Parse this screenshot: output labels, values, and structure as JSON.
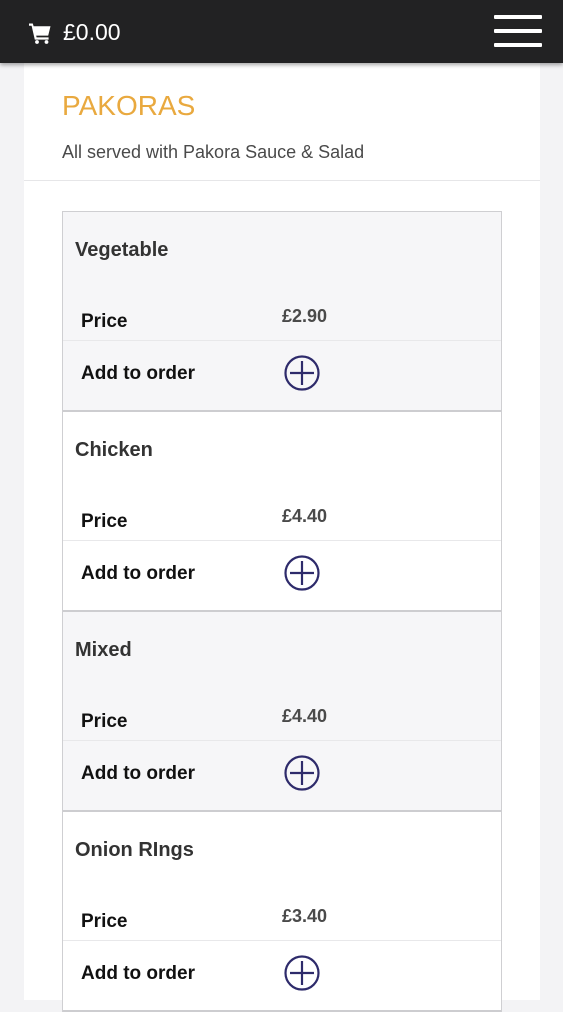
{
  "header": {
    "cart_icon": "shopping-cart-icon",
    "cart_total": "£0.00",
    "menu_icon": "hamburger-menu-icon"
  },
  "section": {
    "title": "PAKORAS",
    "subtitle": "All served with Pakora Sauce & Salad"
  },
  "labels": {
    "price": "Price",
    "add_to_order": "Add to order"
  },
  "items": [
    {
      "name": "Vegetable",
      "price": "£2.90"
    },
    {
      "name": "Chicken",
      "price": "£4.40"
    },
    {
      "name": "Mixed",
      "price": "£4.40"
    },
    {
      "name": "Onion RIngs",
      "price": "£3.40"
    }
  ],
  "colors": {
    "header_bg": "#222223",
    "title": "#e9a93f",
    "add_icon": "#2e2b6b"
  }
}
